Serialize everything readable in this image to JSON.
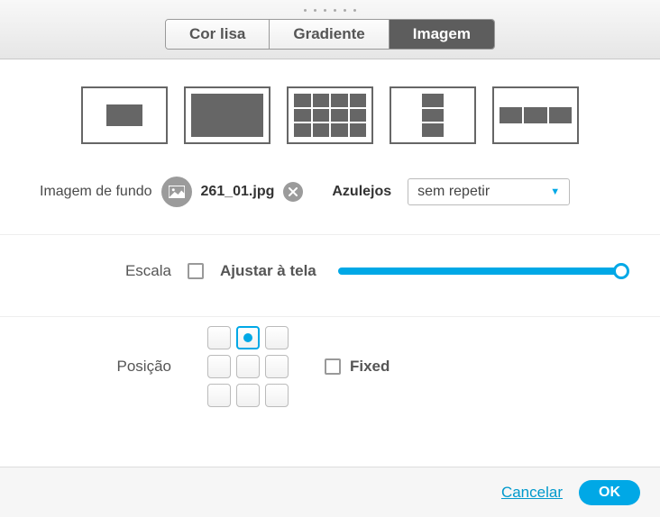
{
  "tabs": {
    "solid": "Cor lisa",
    "gradient": "Gradiente",
    "image": "Imagem"
  },
  "background": {
    "label": "Imagem de fundo",
    "filename": "261_01.jpg"
  },
  "tiles": {
    "label": "Azulejos",
    "selected": "sem repetir"
  },
  "scale": {
    "label": "Escala",
    "fit_label": "Ajustar à tela",
    "value": 100
  },
  "position": {
    "label": "Posição",
    "fixed_label": "Fixed",
    "selected_index": 1
  },
  "footer": {
    "cancel": "Cancelar",
    "ok": "OK"
  }
}
